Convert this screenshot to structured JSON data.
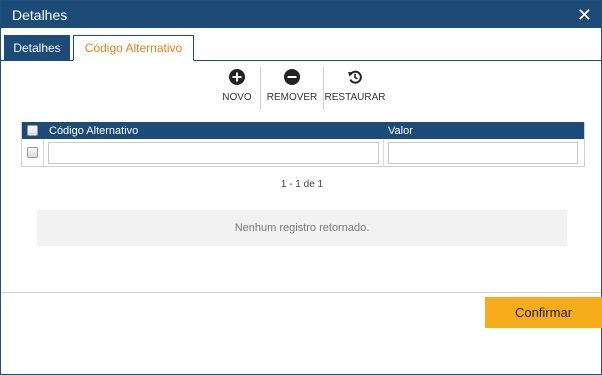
{
  "dialog": {
    "title": "Detalhes",
    "close_icon": "close-icon"
  },
  "tabs": [
    {
      "label": "Detalhes",
      "active": false
    },
    {
      "label": "Código Alternativo",
      "active": true
    }
  ],
  "toolbar": {
    "novo_label": "NOVO",
    "remover_label": "REMOVER",
    "restaurar_label": "RESTAURAR",
    "icons": {
      "novo": "plus-circle-icon",
      "remover": "minus-circle-icon",
      "restaurar": "restore-icon"
    }
  },
  "grid": {
    "columns": [
      "Código Alternativo",
      "Valor"
    ],
    "rows": [
      {
        "codigo": "",
        "valor": ""
      }
    ]
  },
  "pager": {
    "text": "1 - 1 de 1"
  },
  "empty_message": "Nenhum registro retornado.",
  "footer": {
    "confirm_label": "Confirmar"
  },
  "colors": {
    "header": "#1d4b77",
    "accent": "#e87f1e",
    "confirm": "#f7ac1b"
  }
}
